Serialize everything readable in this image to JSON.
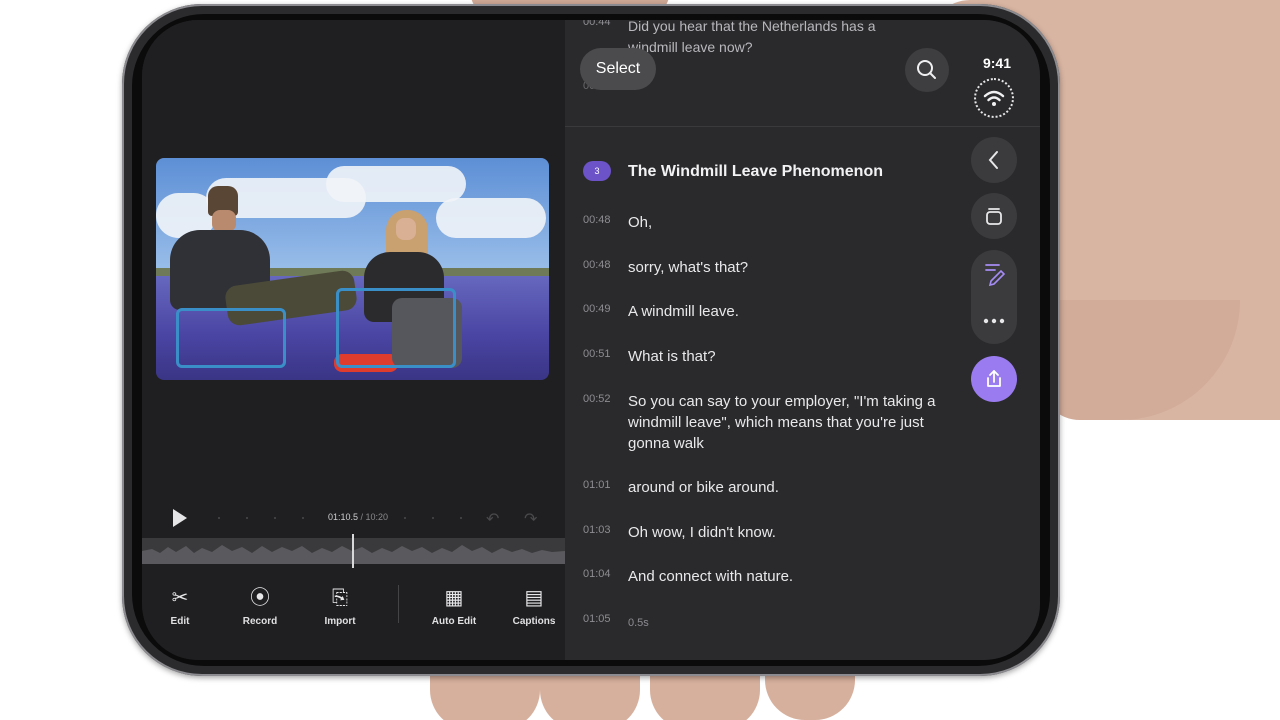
{
  "status_bar": {
    "time": "9:41"
  },
  "header": {
    "select_label": "Select",
    "faded_top_ts": "00:44",
    "faded_top_text": "Did you hear that the Netherlands has a windmill leave now?",
    "faded_top_ts2": "00:45"
  },
  "playback": {
    "current_time": "01:10.5",
    "separator": " / ",
    "total_time": "10:20"
  },
  "toolbar": [
    {
      "label": "Edit",
      "icon": "scissors-icon"
    },
    {
      "label": "Record",
      "icon": "record-icon"
    },
    {
      "label": "Import",
      "icon": "import-icon"
    },
    {
      "label": "Auto Edit",
      "icon": "auto-edit-icon"
    },
    {
      "label": "Captions",
      "icon": "captions-icon"
    }
  ],
  "transcript": {
    "chapter_number": "3",
    "chapter_title": "The Windmill Leave Phenomenon",
    "lines": [
      {
        "ts": "00:48",
        "text": "Oh,"
      },
      {
        "ts": "00:48",
        "text": "sorry, what's that?"
      },
      {
        "ts": "00:49",
        "text": "A windmill leave."
      },
      {
        "ts": "00:51",
        "text": "What is that?"
      },
      {
        "ts": "00:52",
        "text": "So you can say to your employer, \"I'm taking a windmill leave\", which means that you're just gonna walk"
      },
      {
        "ts": "01:01",
        "text": "around or bike around."
      },
      {
        "ts": "01:03",
        "text": "Oh wow, I didn't know."
      },
      {
        "ts": "01:04",
        "text": "And connect with nature."
      },
      {
        "ts": "01:05",
        "text": "0.5s"
      }
    ]
  },
  "colors": {
    "accent": "#9a7cf0",
    "chapter_badge": "#6c53c8",
    "background": "#2a2a2c"
  }
}
